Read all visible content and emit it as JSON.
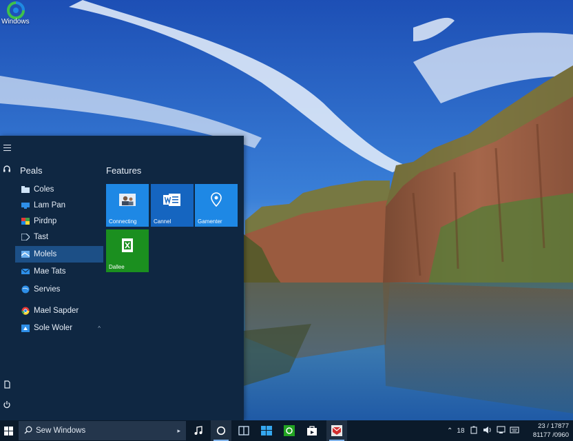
{
  "desktop": {
    "logo_label": "Windows"
  },
  "start_menu": {
    "apps_header": "Peals",
    "tiles_header": "Features",
    "apps": [
      {
        "label": "Coles",
        "icon": "folder-icon",
        "selected": false
      },
      {
        "label": "Lam Pan",
        "icon": "monitor-icon",
        "selected": false
      },
      {
        "label": "Pirdnp",
        "icon": "photos-icon",
        "selected": false
      },
      {
        "label": "Tast",
        "icon": "tag-icon",
        "selected": false
      },
      {
        "label": "Molels",
        "icon": "maps-icon",
        "selected": true
      },
      {
        "label": "Mae Tats",
        "icon": "mail-icon",
        "selected": false
      },
      {
        "label": "Servies",
        "icon": "globe-icon",
        "selected": false
      },
      {
        "label": "Mael Sapder",
        "icon": "chrome-icon",
        "selected": false
      },
      {
        "label": "Sole Woler",
        "icon": "store-icon",
        "selected": false,
        "has_submenu": true
      }
    ],
    "tiles": [
      {
        "label": "Connecting",
        "icon": "people-icon",
        "color": "#1e88e5"
      },
      {
        "label": "Cannel",
        "icon": "word-icon",
        "color": "#1565c0"
      },
      {
        "label": "Gamenter",
        "icon": "location-icon",
        "color": "#1e88e5"
      },
      {
        "label": "Dallee",
        "icon": "excel-icon",
        "color": "#1b8f1f"
      }
    ]
  },
  "taskbar": {
    "search_placeholder": "Sew Windows",
    "apps": [
      {
        "name": "music-icon",
        "active": false
      },
      {
        "name": "cortana-icon",
        "active": true
      },
      {
        "name": "task-view-icon",
        "active": false
      },
      {
        "name": "explorer-icon",
        "active": false
      },
      {
        "name": "xbox-icon",
        "active": false
      },
      {
        "name": "store-icon",
        "active": false
      },
      {
        "name": "photos-app-icon",
        "active": true
      }
    ],
    "tray_text": "18",
    "clock_time": "23 / 17877",
    "clock_date": "81177 /0960"
  },
  "colors": {
    "start_bg": "#0f2742",
    "taskbar_bg": "#0b1a2a",
    "selection": "#1c4f86",
    "accent": "#1e88e5"
  }
}
